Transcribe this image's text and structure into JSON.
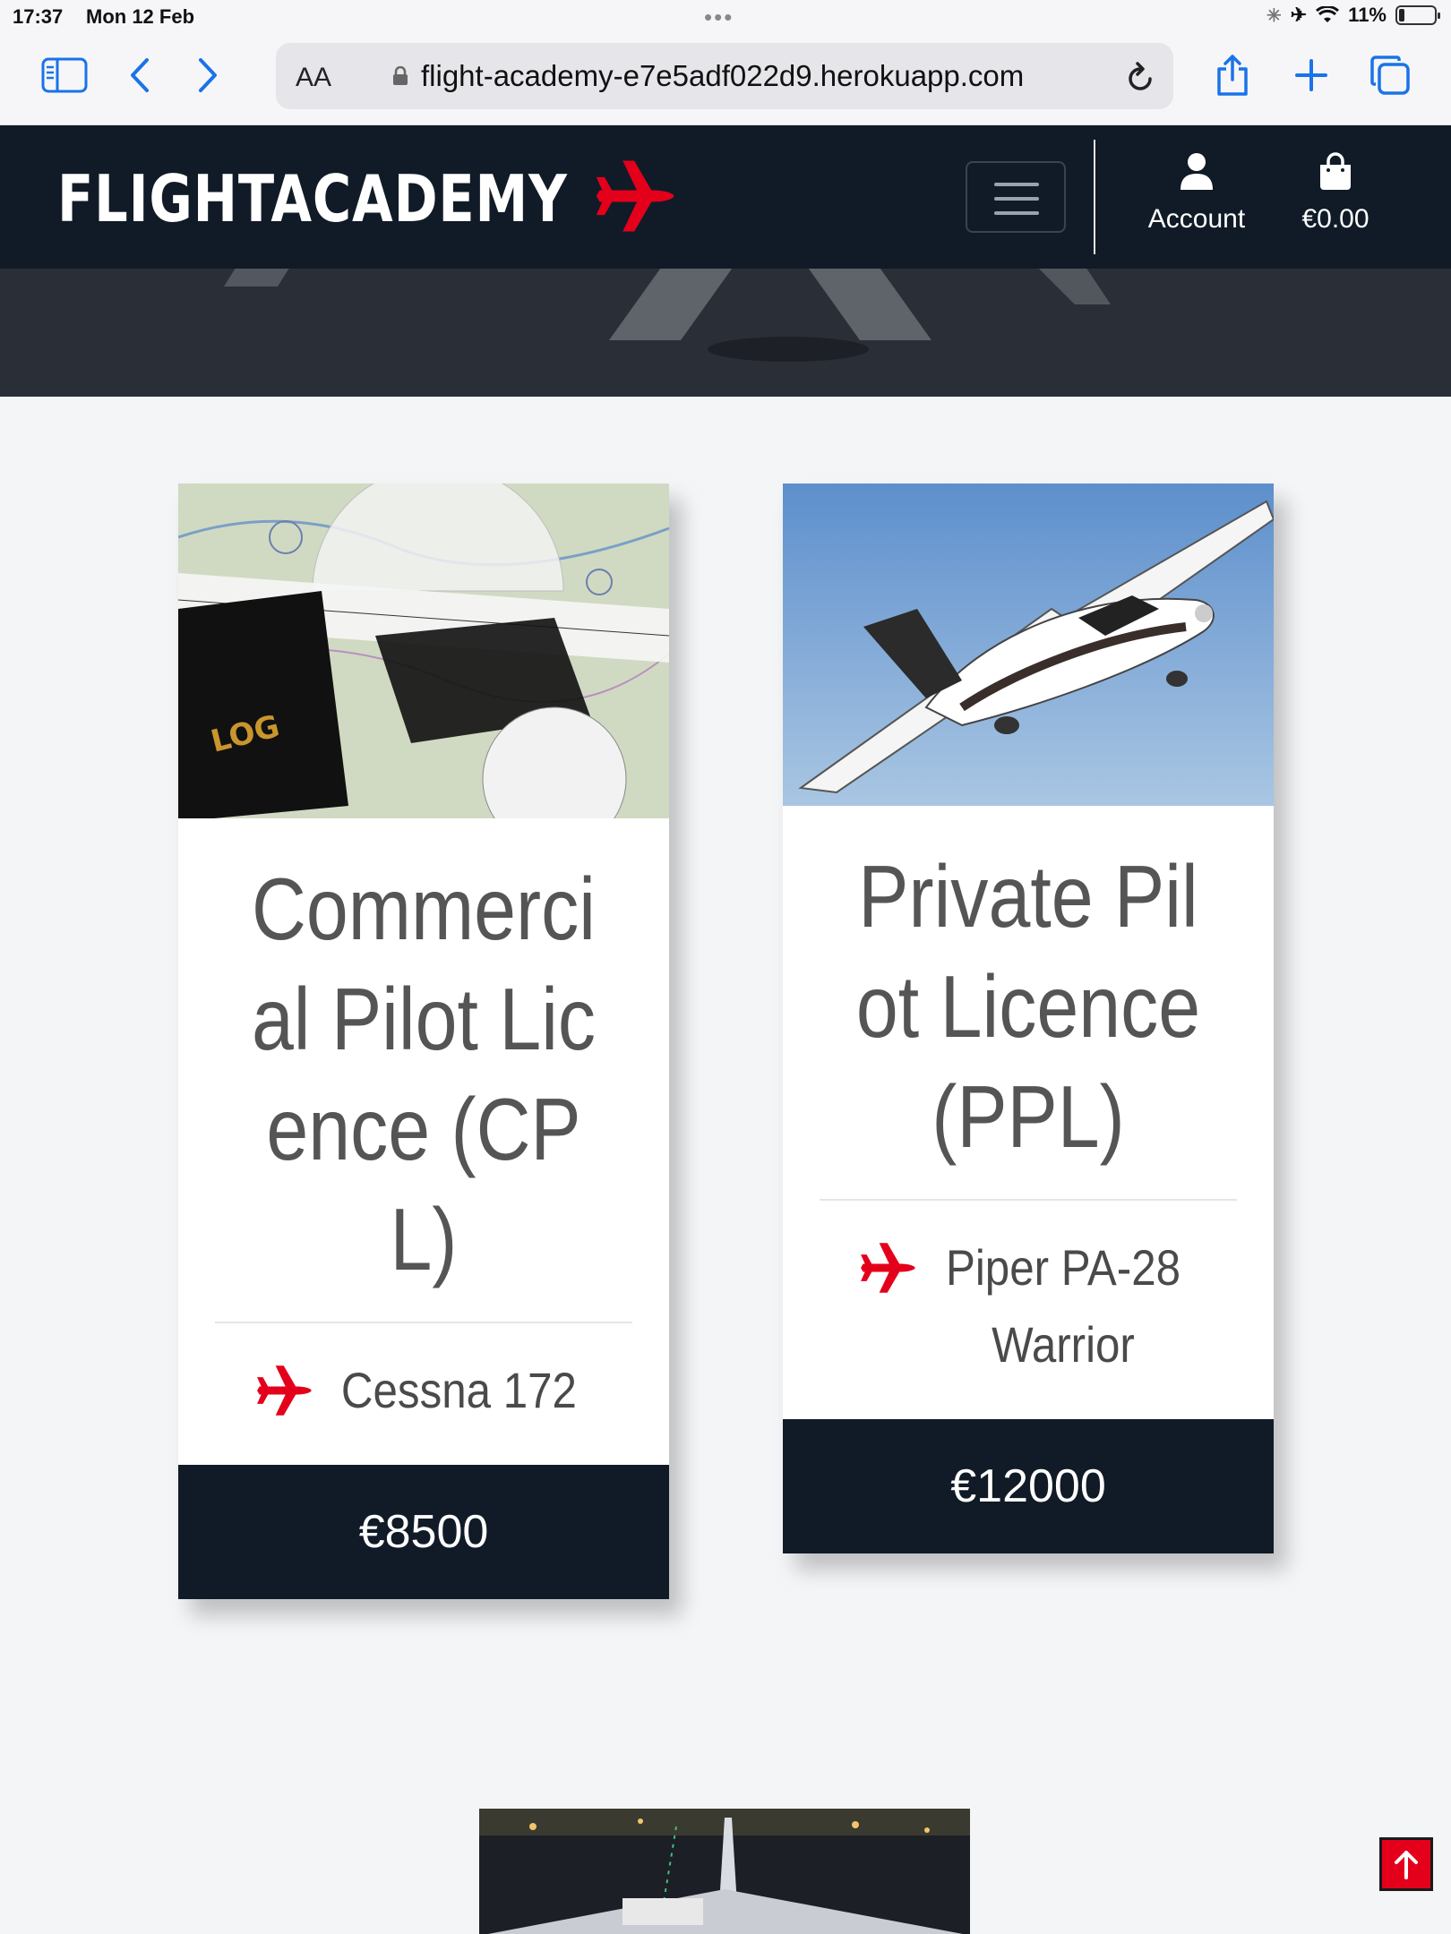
{
  "status_bar": {
    "time": "17:37",
    "date": "Mon 12 Feb",
    "battery": "11%"
  },
  "browser": {
    "text_size_button": "AA",
    "url": "flight-academy-e7e5adf022d9.herokuapp.com"
  },
  "navbar": {
    "brand": "FLIGHTACADEMY",
    "account_label": "Account",
    "cart_total": "€0.00"
  },
  "products": [
    {
      "title": "Commercial Pilot Licence (CPL)",
      "aircraft": "Cessna 172",
      "price": "€8500"
    },
    {
      "title": "Private Pilot Licence (PPL)",
      "aircraft": "Piper PA-28 Warrior",
      "price": "€12000"
    }
  ],
  "colors": {
    "navy": "#111b27",
    "accent_red": "#e4001b",
    "page_bg": "#f4f5f7"
  },
  "icons": [
    "sidebar-icon",
    "back-icon",
    "forward-icon",
    "lock-icon",
    "reload-icon",
    "share-icon",
    "new-tab-icon",
    "tabs-icon",
    "plane-icon",
    "user-icon",
    "shopping-bag-icon",
    "arrow-up-icon"
  ]
}
